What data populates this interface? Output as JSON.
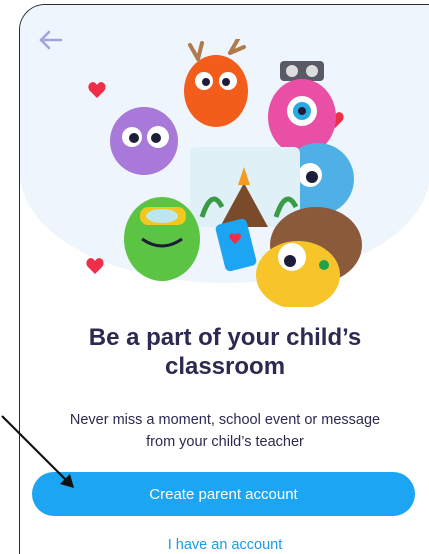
{
  "onboarding": {
    "title_line1": "Be a part of your child’s",
    "title_line2": "classroom",
    "subtitle_line1": "Never miss a moment, school event or message",
    "subtitle_line2": "from your child’s teacher",
    "primary_button": "Create parent account",
    "secondary_link": "I have an account"
  },
  "icons": {
    "back": "arrow-left-icon",
    "pointer": "annotation-arrow"
  },
  "colors": {
    "accent": "#1ba5f2",
    "link": "#1a9be6",
    "heading": "#2c2a50",
    "hero_background": "#eef5fd",
    "back_icon": "#a6a3db"
  }
}
